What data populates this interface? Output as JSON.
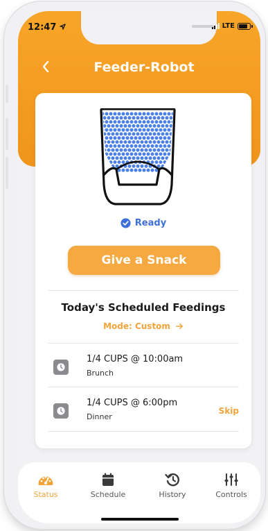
{
  "status_bar": {
    "time": "12:47",
    "network": "LTE"
  },
  "header": {
    "title": "Feeder-Robot"
  },
  "feeder": {
    "status": "Ready"
  },
  "actions": {
    "snack_label": "Give a Snack"
  },
  "schedule": {
    "title": "Today's Scheduled Feedings",
    "mode": "Mode: Custom",
    "feedings": [
      {
        "amount": "1/4 CUPS @ 10:00am",
        "name": "Brunch"
      },
      {
        "amount": "1/4 CUPS @ 6:00pm",
        "name": "Dinner",
        "action": "Skip"
      }
    ]
  },
  "tabs": [
    {
      "label": "Status",
      "icon": "dashboard-gauge-icon",
      "active": true
    },
    {
      "label": "Schedule",
      "icon": "calendar-icon",
      "active": false
    },
    {
      "label": "History",
      "icon": "history-icon",
      "active": false
    },
    {
      "label": "Controls",
      "icon": "sliders-icon",
      "active": false
    }
  ],
  "colors": {
    "accent": "#f6a940",
    "header": "#f7a528",
    "ready": "#3d6fd8",
    "food": "#4a80e8"
  }
}
